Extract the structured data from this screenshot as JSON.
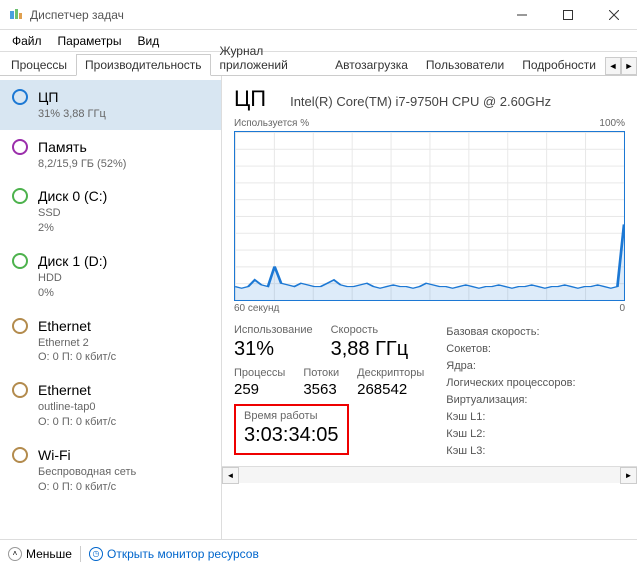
{
  "window": {
    "title": "Диспетчер задач"
  },
  "menu": {
    "file": "Файл",
    "options": "Параметры",
    "view": "Вид"
  },
  "tabs": {
    "t0": "Процессы",
    "t1": "Производительность",
    "t2": "Журнал приложений",
    "t3": "Автозагрузка",
    "t4": "Пользователи",
    "t5": "Подробности"
  },
  "sidebar": {
    "cpu": {
      "name": "ЦП",
      "sub": "31% 3,88 ГГц"
    },
    "mem": {
      "name": "Память",
      "sub": "8,2/15,9 ГБ (52%)"
    },
    "disk0": {
      "name": "Диск 0 (C:)",
      "sub1": "SSD",
      "sub2": "2%"
    },
    "disk1": {
      "name": "Диск 1 (D:)",
      "sub1": "HDD",
      "sub2": "0%"
    },
    "eth0": {
      "name": "Ethernet",
      "sub1": "Ethernet 2",
      "sub2": "О: 0 П: 0 кбит/с"
    },
    "eth1": {
      "name": "Ethernet",
      "sub1": "outline-tap0",
      "sub2": "О: 0 П: 0 кбит/с"
    },
    "wifi": {
      "name": "Wi-Fi",
      "sub1": "Беспроводная сеть",
      "sub2": "О: 0 П: 0 кбит/с"
    }
  },
  "main": {
    "title": "ЦП",
    "model": "Intel(R) Core(TM) i7-9750H CPU @ 2.60GHz",
    "chart_top_left": "Используется %",
    "chart_top_right": "100%",
    "chart_bottom_left": "60 секунд",
    "chart_bottom_right": "0",
    "stats": {
      "usage_label": "Использование",
      "usage_value": "31%",
      "speed_label": "Скорость",
      "speed_value": "3,88 ГГц",
      "procs_label": "Процессы",
      "procs_value": "259",
      "threads_label": "Потоки",
      "threads_value": "3563",
      "handles_label": "Дескрипторы",
      "handles_value": "268542",
      "uptime_label": "Время работы",
      "uptime_value": "3:03:34:05"
    },
    "right": {
      "base_speed": "Базовая скорость:",
      "sockets": "Сокетов:",
      "cores": "Ядра:",
      "logical": "Логических процессоров:",
      "virt": "Виртуализация:",
      "l1": "Кэш L1:",
      "l2": "Кэш L2:",
      "l3": "Кэш L3:"
    }
  },
  "footer": {
    "less": "Меньше",
    "resmon": "Открыть монитор ресурсов"
  },
  "chart_data": {
    "type": "area",
    "title": "ЦП — Используется %",
    "xlabel": "60 секунд",
    "ylabel": "Используется %",
    "ylim": [
      0,
      100
    ],
    "x": [
      0,
      1,
      2,
      3,
      4,
      5,
      6,
      7,
      8,
      9,
      10,
      11,
      12,
      13,
      14,
      15,
      16,
      17,
      18,
      19,
      20,
      21,
      22,
      23,
      24,
      25,
      26,
      27,
      28,
      29,
      30,
      31,
      32,
      33,
      34,
      35,
      36,
      37,
      38,
      39,
      40,
      41,
      42,
      43,
      44,
      45,
      46,
      47,
      48,
      49,
      50,
      51,
      52,
      53,
      54,
      55,
      56,
      57,
      58,
      59
    ],
    "values": [
      8,
      7,
      8,
      12,
      9,
      8,
      20,
      10,
      9,
      8,
      10,
      9,
      8,
      8,
      10,
      12,
      9,
      8,
      8,
      9,
      10,
      8,
      7,
      8,
      9,
      8,
      8,
      7,
      8,
      10,
      9,
      8,
      8,
      7,
      8,
      9,
      8,
      7,
      8,
      8,
      9,
      8,
      7,
      8,
      8,
      9,
      8,
      7,
      8,
      8,
      9,
      8,
      7,
      8,
      8,
      9,
      8,
      7,
      8,
      45
    ]
  }
}
